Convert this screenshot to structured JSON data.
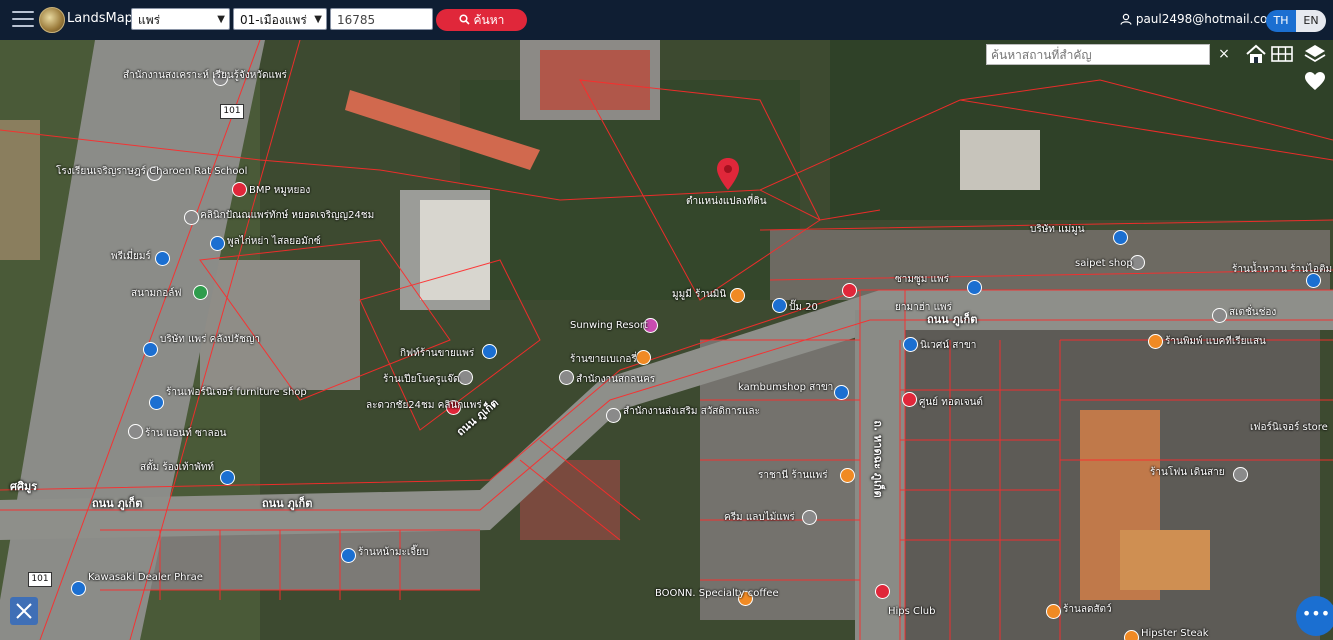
{
  "header": {
    "brand": "LandsMaps",
    "province": "แพร่",
    "district": "01-เมืองแพร่",
    "parcel_no": "16785",
    "search_label": "ค้นหา",
    "user_email": "paul2498@hotmail.com",
    "lang_th": "TH",
    "lang_en": "EN"
  },
  "map": {
    "place_search_placeholder": "ค้นหาสถานที่สำคัญ",
    "clear_symbol": "×",
    "pin_label": "ตำแหน่งแปลงที่ดิน",
    "fab_symbol": "•••",
    "route_shield_top": "101",
    "route_shield_bottom": "101",
    "roads": [
      "ถนน ภูเก็ต",
      "ถนน ภูเก็ต",
      "ถนน ภูเก็ต",
      "ถนน ภูเก็ต",
      "ถ. หาดฉะ ภูเก็ต",
      "ศศิมูร"
    ],
    "places": [
      "สำนักงานสงเคราะห์ เรียนรู้จังหวัดแพร่",
      "โรงเรียนเจริญราษฎร์ Charoen Rat School",
      "BMP หมูหยอง",
      "คลินิกปัณณแพร่ทักษ์ หยอดเจริญญ24ชม",
      "พูลไก่หย่า ไสลยอมักซ์",
      "พรีเมี่ยมร์",
      "สนามกอล์ฟ",
      "บริษัท แพร่ คลังปรัชญา",
      "ร้านเฟอร์นิเจอร์ furniture shop",
      "ร้าน แอนท์ ซาลอน",
      "สตั้ม ร้องเท้าพัทท์",
      "Sunwing Resort",
      "กิฟท์ร้านขายแพร่",
      "ร้านเปียโนครูแจ๊ด",
      "ละดวกชัย24ชม คลินิกแพร่",
      "ร้านขายเบเกอรี่",
      "สำนักงานสกลนคร",
      "สำนักงานส่งเสริม สวัสดิการและ",
      "มูมูมี ร้านมินิ",
      "ปั๊ม 20",
      "kambumshop สาขา",
      "Kawasaki Dealer Phrae",
      "ร้านหน้ามะเจี๊ยบ",
      "ซามซูม แพร่",
      "ราชานี ร้านแพร่",
      "ครีม แลบไม้แพร่",
      "Hipster Steak",
      "saipet shop",
      "บริษัท แม่มูน",
      "ยามาฮ่า แพร่",
      "นิเวศน์ สาขา",
      "BOONN. Specialty coffee",
      "Hips Club",
      "ร้านพิมพ์ แบคทีเรียแสน",
      "ร้านลดสัตว์",
      "ศูนย์ ทอดเจนต์",
      "เฟอร์นิเจอร์ store",
      "ร้านน้ำหวาน ร้านไอติม",
      "ร้านโฟน เดินสาย",
      "สเตชั่นช่อง"
    ]
  }
}
